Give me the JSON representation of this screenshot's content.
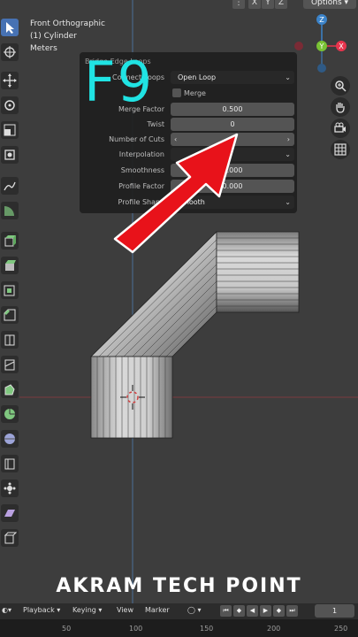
{
  "viewport_info": {
    "view_name": "Front Orthographic",
    "object_name": "(1) Cylinder",
    "units": "Meters"
  },
  "header": {
    "axis_buttons": [
      "X",
      "Y",
      "Z"
    ],
    "options_label": "Options"
  },
  "gizmo": {
    "x": "X",
    "y": "Y",
    "z": "Z"
  },
  "overlay": {
    "key_label": "F9",
    "watermark": "AKRAM TECH POINT",
    "arrow_color": "#e8121a",
    "key_color": "#20e3e3"
  },
  "panel": {
    "title": "Bridge Edge Loops",
    "connect_loops": {
      "label": "Connect Loops",
      "value": "Open Loop"
    },
    "merge": {
      "label": "Merge",
      "checked": false
    },
    "merge_factor": {
      "label": "Merge Factor",
      "value": "0.500"
    },
    "twist": {
      "label": "Twist",
      "value": "0"
    },
    "number_of_cuts": {
      "label": "Number of Cuts",
      "value": "0"
    },
    "interpolation": {
      "label": "Interpolation",
      "value": ""
    },
    "smoothness": {
      "label": "Smoothness",
      "value": "1.000"
    },
    "profile_factor": {
      "label": "Profile Factor",
      "value": "0.000"
    },
    "profile_shape": {
      "label": "Profile Shape",
      "value": "Smooth"
    }
  },
  "timeline": {
    "menus": [
      "Playback",
      "Keying",
      "View",
      "Marker"
    ],
    "current_frame": "1",
    "ruler_ticks": [
      "50",
      "100",
      "150",
      "200",
      "250"
    ]
  },
  "colors": {
    "selection_accent": "#4772b3",
    "x_axis": "#e8344d",
    "y_axis": "#79c234",
    "z_axis": "#3b83c9"
  }
}
